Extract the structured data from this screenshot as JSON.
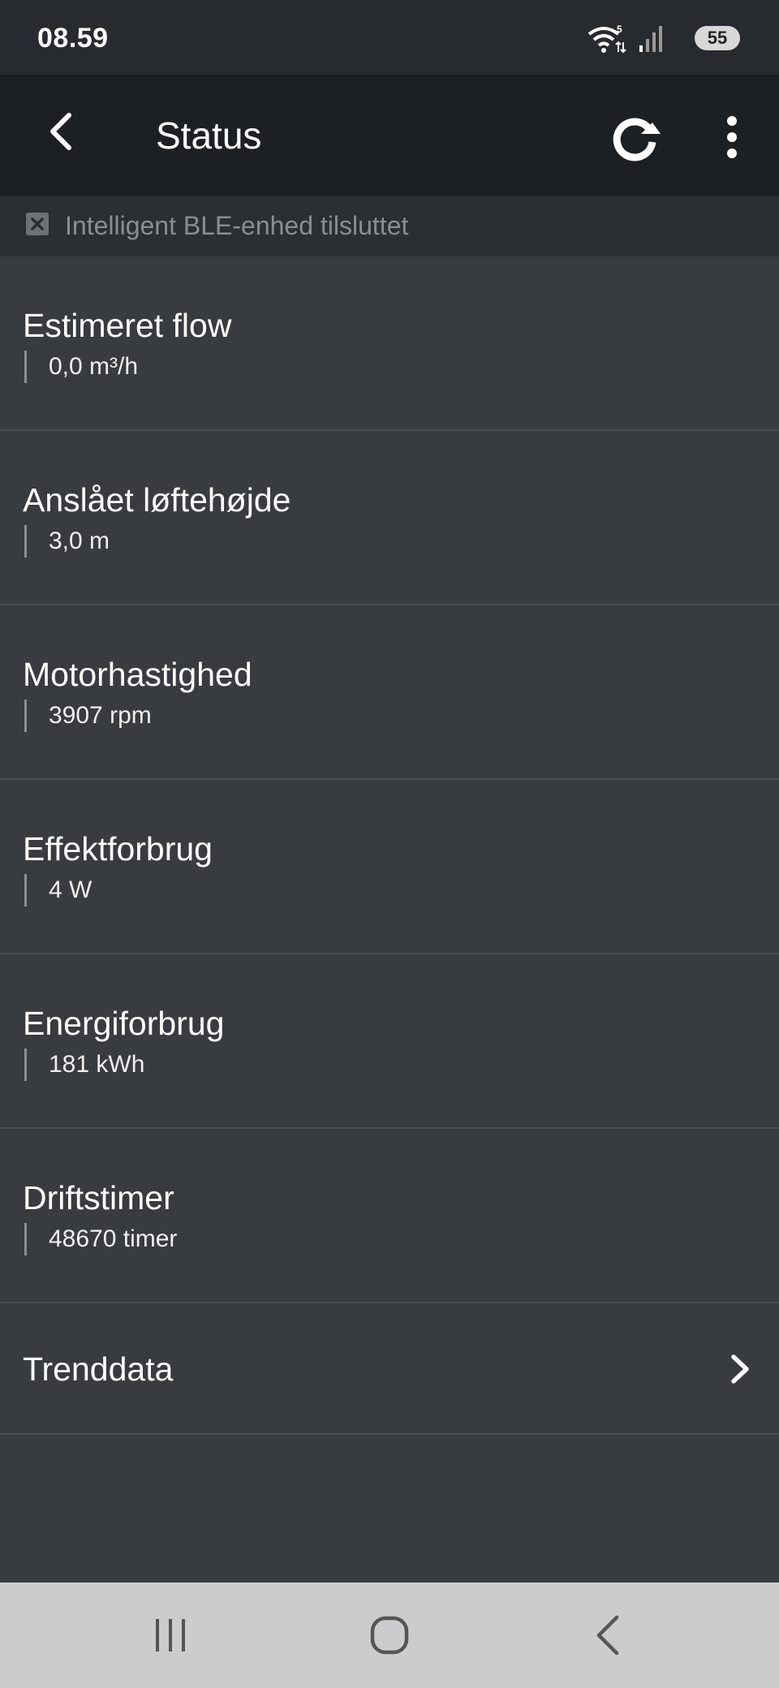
{
  "status_bar": {
    "time": "08.59",
    "battery": "55",
    "wifi_badge": "5"
  },
  "app_bar": {
    "title": "Status",
    "back_icon": "chevron-left-icon",
    "refresh_icon": "refresh-icon",
    "more_icon": "more-vertical-icon"
  },
  "banner": {
    "text": "Intelligent BLE-enhed tilsluttet",
    "icon": "close-box-icon"
  },
  "items": [
    {
      "label": "Estimeret flow",
      "value": "0,0 m³/h"
    },
    {
      "label": "Anslået løftehøjde",
      "value": "3,0 m"
    },
    {
      "label": "Motorhastighed",
      "value": "3907 rpm"
    },
    {
      "label": "Effektforbrug",
      "value": "4 W"
    },
    {
      "label": "Energiforbrug",
      "value": "181 kWh"
    },
    {
      "label": "Driftstimer",
      "value": "48670 timer"
    }
  ],
  "trend": {
    "label": "Trenddata",
    "icon": "chevron-right-icon"
  },
  "nav": {
    "recents_icon": "recents-icon",
    "home_icon": "home-icon",
    "back_icon": "back-icon"
  },
  "colors": {
    "background": "#383c41",
    "app_bar": "#1d2023",
    "status_bar": "#272b2f",
    "banner": "#2b2f33",
    "nav_bar": "#cbcccd"
  }
}
